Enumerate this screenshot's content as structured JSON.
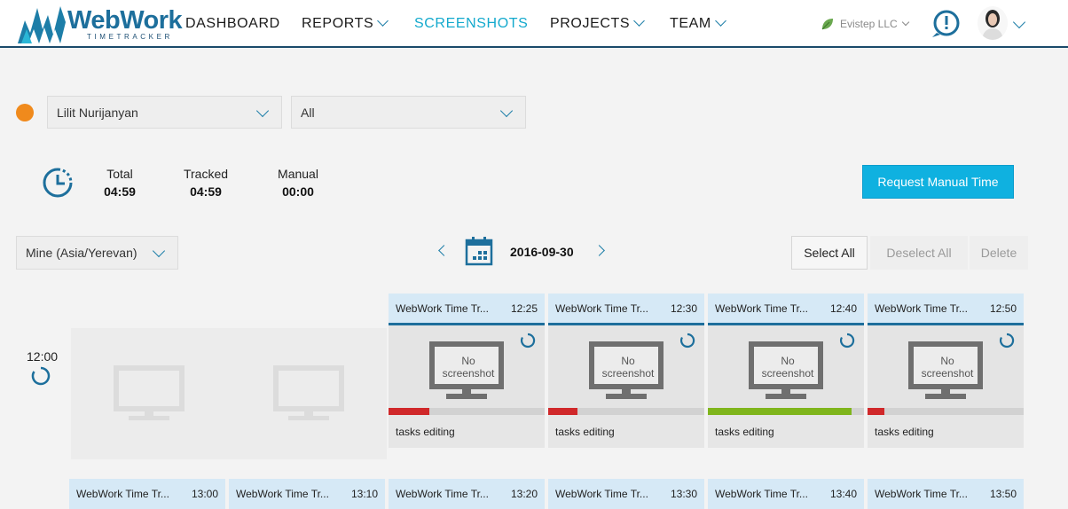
{
  "app": {
    "logo_name": "WebWork",
    "logo_sub": "TIMETRACKER"
  },
  "nav": {
    "dashboard": "DASHBOARD",
    "reports": "REPORTS",
    "screenshots": "SCREENSHOTS",
    "projects": "PROJECTS",
    "team": "TEAM"
  },
  "header": {
    "company": "Evistep LLC",
    "help_icon": "chat-exclamation-icon",
    "avatar_icon": "user-avatar"
  },
  "filters": {
    "user": "Lilit Nurijanyan",
    "project": "All",
    "status_color": "#f08a1c"
  },
  "stats": {
    "total_label": "Total",
    "total_value": "04:59",
    "tracked_label": "Tracked",
    "tracked_value": "04:59",
    "manual_label": "Manual",
    "manual_value": "00:00",
    "request_button": "Request Manual Time"
  },
  "datebar": {
    "timezone": "Mine (Asia/Yerevan)",
    "date": "2016-09-30",
    "select_all": "Select All",
    "deselect_all": "Deselect All",
    "delete": "Delete"
  },
  "grid": {
    "row_time": "12:00",
    "no_screenshot_line1": "No",
    "no_screenshot_line2": "screenshot",
    "cards": [
      {
        "app": "WebWork Time Tr...",
        "time": "12:25",
        "activity": 0.26,
        "activity_color": "#d0282a",
        "task": "tasks editing"
      },
      {
        "app": "WebWork Time Tr...",
        "time": "12:30",
        "activity": 0.19,
        "activity_color": "#d0282a",
        "task": "tasks editing"
      },
      {
        "app": "WebWork Time Tr...",
        "time": "12:40",
        "activity": 0.92,
        "activity_color": "#7fb51c",
        "task": "tasks editing"
      },
      {
        "app": "WebWork Time Tr...",
        "time": "12:50",
        "activity": 0.11,
        "activity_color": "#d0282a",
        "task": "tasks editing"
      }
    ],
    "next_row": [
      {
        "app": "WebWork Time Tr...",
        "time": "13:00"
      },
      {
        "app": "WebWork Time Tr...",
        "time": "13:10"
      },
      {
        "app": "WebWork Time Tr...",
        "time": "13:20"
      },
      {
        "app": "WebWork Time Tr...",
        "time": "13:30"
      },
      {
        "app": "WebWork Time Tr...",
        "time": "13:40"
      },
      {
        "app": "WebWork Time Tr...",
        "time": "13:50"
      }
    ]
  }
}
